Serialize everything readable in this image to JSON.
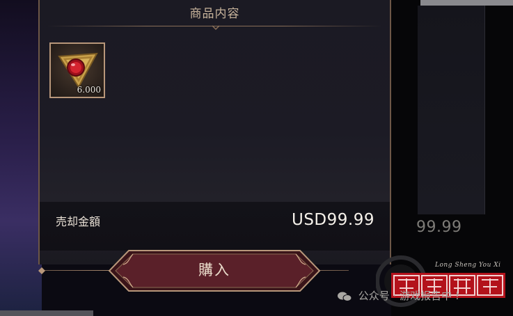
{
  "panel": {
    "title": "商品内容",
    "item": {
      "icon": "ruby-triangle-gem-icon",
      "quantity": "6.000"
    },
    "price": {
      "label": "売却金額",
      "value": "USD99.99"
    }
  },
  "buy_button": {
    "label": "購入"
  },
  "background": {
    "right_card_price": "99.99"
  },
  "watermark": {
    "wechat_text": "公众号 · 游戏报告中 !",
    "seal_script": "Long Sheng You Xi"
  },
  "colors": {
    "panel_border": "#6d5747",
    "gold_accent": "#b8977a",
    "button_fill": "#5a2029",
    "text_light": "#f5f1ea"
  }
}
